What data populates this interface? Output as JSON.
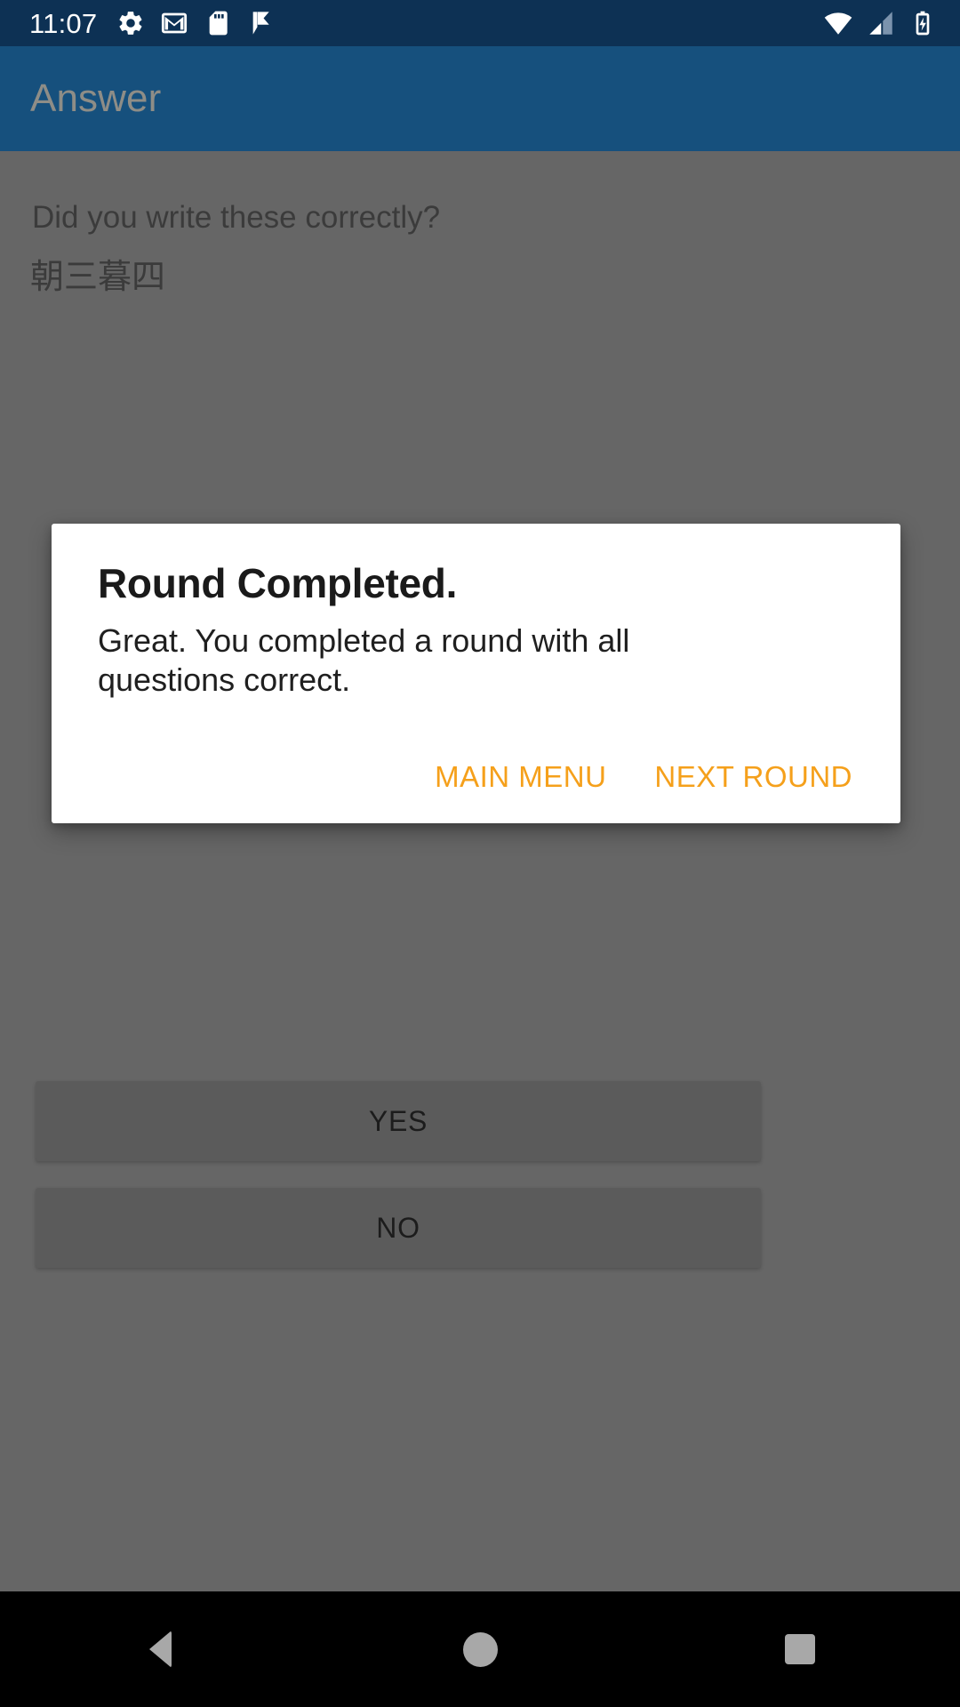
{
  "status_bar": {
    "time": "11:07",
    "left_icons": [
      "gear-icon",
      "gmail-icon",
      "sd-card-icon",
      "checkmark-flag-icon"
    ],
    "right_icons": [
      "wifi-icon",
      "cellular-signal-icon",
      "battery-charging-icon"
    ],
    "background_color": "#0d3154",
    "foreground_color": "#ffffff"
  },
  "app_bar": {
    "title": "Answer",
    "background_color": "#16507d",
    "title_color": "#8e8d87"
  },
  "content": {
    "prompt": "Did you write these correctly?",
    "phrase": "朝三暮四",
    "scrim_color": "#666666",
    "buttons": [
      {
        "label": "YES",
        "name": "yes-button"
      },
      {
        "label": "NO",
        "name": "no-button"
      }
    ]
  },
  "dialog": {
    "title": "Round Completed.",
    "message": "Great. You completed a round with all questions correct.",
    "accent_color": "#f5a01b",
    "background_color": "#ffffff",
    "actions": [
      {
        "label": "MAIN MENU",
        "name": "main-menu-button"
      },
      {
        "label": "NEXT ROUND",
        "name": "next-round-button"
      }
    ]
  },
  "nav_bar": {
    "background_color": "#000000",
    "icon_color": "#a8a8a8",
    "buttons": [
      "back-nav-button",
      "home-nav-button",
      "recents-nav-button"
    ]
  }
}
